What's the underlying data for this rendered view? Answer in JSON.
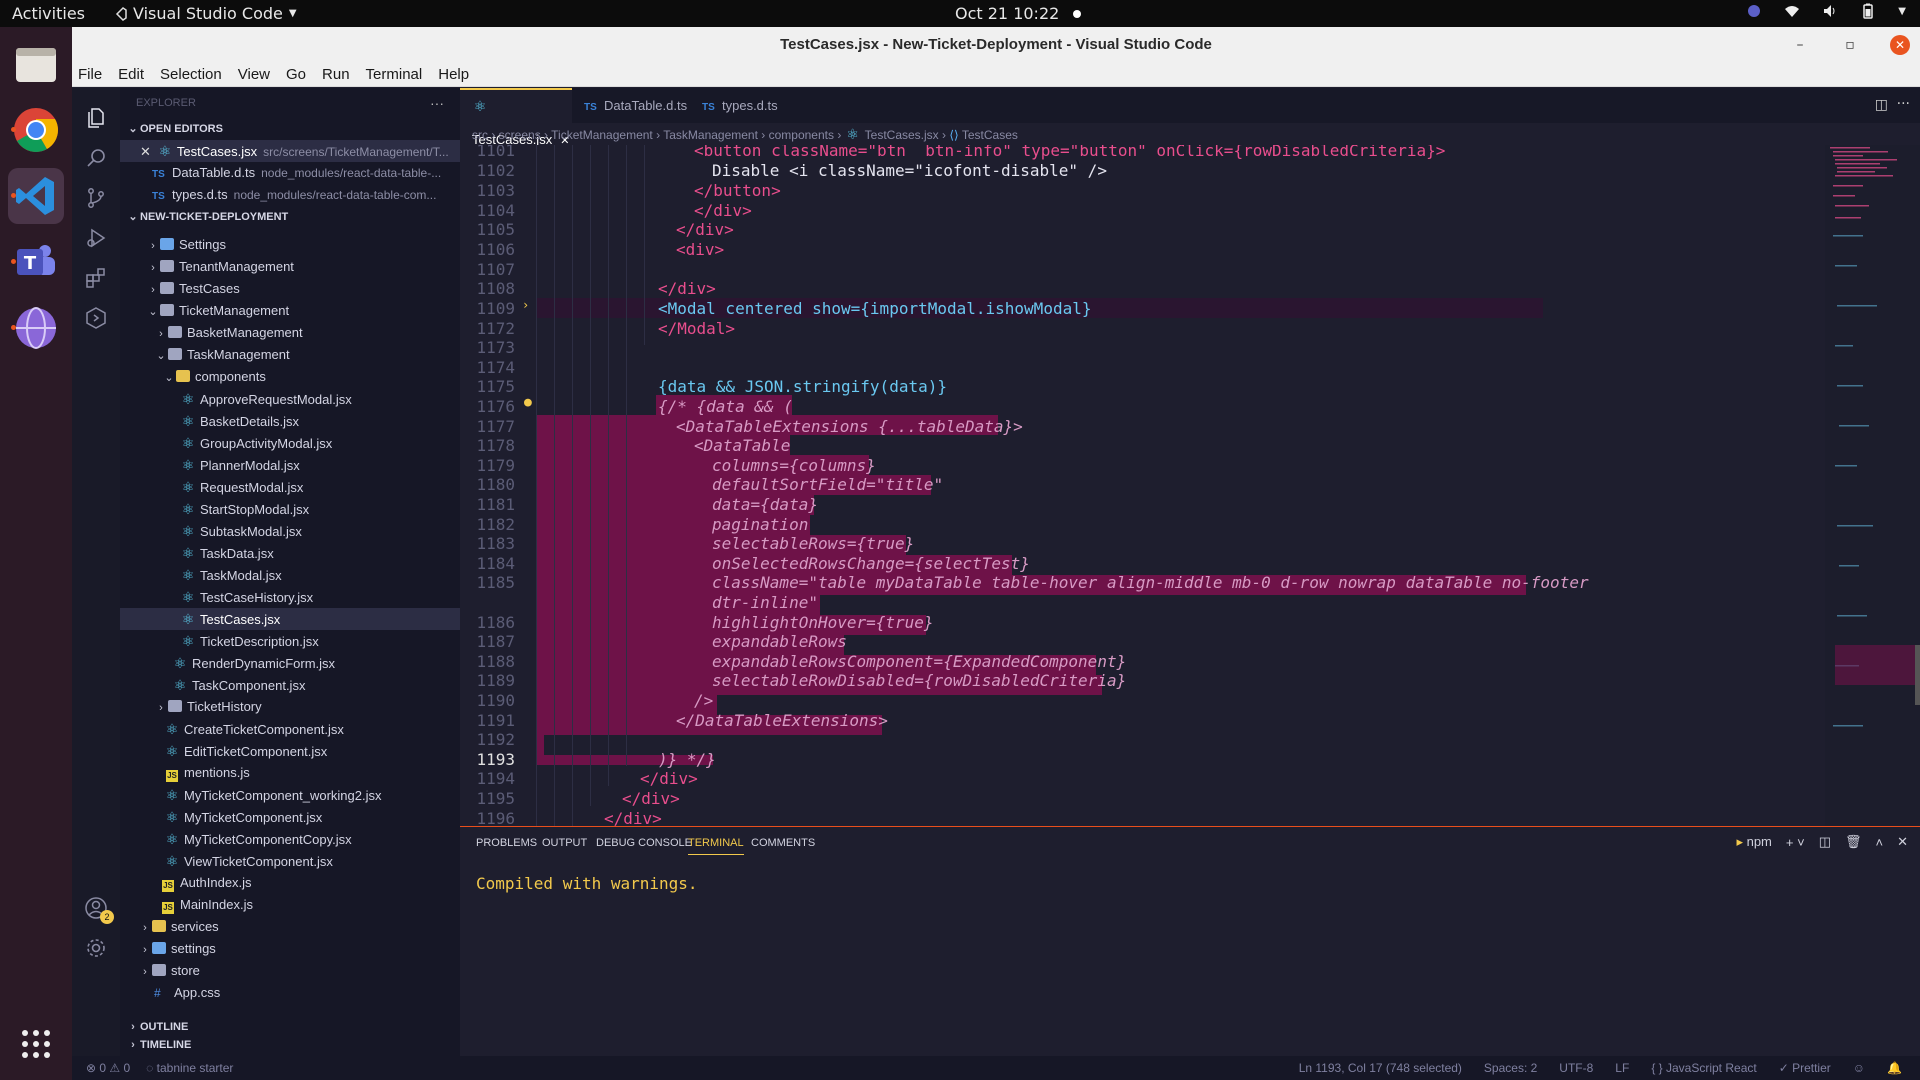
{
  "topbar": {
    "activities": "Activities",
    "app_name": "Visual Studio Code",
    "clock": "Oct 21  10:22"
  },
  "window": {
    "title": "TestCases.jsx - New-Ticket-Deployment - Visual Studio Code"
  },
  "menu": [
    "File",
    "Edit",
    "Selection",
    "View",
    "Go",
    "Run",
    "Terminal",
    "Help"
  ],
  "sidebar": {
    "title": "EXPLORER",
    "open_editors_label": "OPEN EDITORS",
    "open_editors": [
      {
        "name": "TestCases.jsx",
        "path": "src/screens/TicketManagement/T..."
      },
      {
        "name": "DataTable.d.ts",
        "path": "node_modules/react-data-table-..."
      },
      {
        "name": "types.d.ts",
        "path": "node_modules/react-data-table-com..."
      }
    ],
    "project_label": "NEW-TICKET-DEPLOYMENT",
    "tree": [
      {
        "label": "Settings"
      },
      {
        "label": "TenantManagement"
      },
      {
        "label": "TestCases"
      },
      {
        "label": "TicketManagement"
      },
      {
        "label": "BasketManagement"
      },
      {
        "label": "TaskManagement"
      },
      {
        "label": "components"
      },
      {
        "label": "ApproveRequestModal.jsx"
      },
      {
        "label": "BasketDetails.jsx"
      },
      {
        "label": "GroupActivityModal.jsx"
      },
      {
        "label": "PlannerModal.jsx"
      },
      {
        "label": "RequestModal.jsx"
      },
      {
        "label": "StartStopModal.jsx"
      },
      {
        "label": "SubtaskModal.jsx"
      },
      {
        "label": "TaskData.jsx"
      },
      {
        "label": "TaskModal.jsx"
      },
      {
        "label": "TestCaseHistory.jsx"
      },
      {
        "label": "TestCases.jsx"
      },
      {
        "label": "TicketDescription.jsx"
      },
      {
        "label": "RenderDynamicForm.jsx"
      },
      {
        "label": "TaskComponent.jsx"
      },
      {
        "label": "TicketHistory"
      },
      {
        "label": "CreateTicketComponent.jsx"
      },
      {
        "label": "EditTicketComponent.jsx"
      },
      {
        "label": "mentions.js"
      },
      {
        "label": "MyTicketComponent_working2.jsx"
      },
      {
        "label": "MyTicketComponent.jsx"
      },
      {
        "label": "MyTicketComponentCopy.jsx"
      },
      {
        "label": "ViewTicketComponent.jsx"
      },
      {
        "label": "AuthIndex.js"
      },
      {
        "label": "MainIndex.js"
      },
      {
        "label": "services"
      },
      {
        "label": "settings"
      },
      {
        "label": "store"
      },
      {
        "label": "App.css"
      }
    ],
    "outline_label": "OUTLINE",
    "timeline_label": "TIMELINE"
  },
  "tabs": [
    {
      "label": "TestCases.jsx"
    },
    {
      "label": "DataTable.d.ts"
    },
    {
      "label": "types.d.ts"
    }
  ],
  "breadcrumb": [
    "src",
    "screens",
    "TicketManagement",
    "TaskManagement",
    "components",
    "TestCases.jsx",
    "TestCases"
  ],
  "code": [
    {
      "n": "1101",
      "text": "<button className=\"btn  btn-info\" type=\"button\" onClick={rowDisabledCriteria}>"
    },
    {
      "n": "1102",
      "text": "Disable <i className=\"icofont-disable\" />"
    },
    {
      "n": "1103",
      "text": "</button>"
    },
    {
      "n": "1104",
      "text": "</div>"
    },
    {
      "n": "1105",
      "text": "</div>"
    },
    {
      "n": "1106",
      "text": "<div>"
    },
    {
      "n": "1107",
      "text": ""
    },
    {
      "n": "1108",
      "text": "</div>"
    },
    {
      "n": "1109",
      "text": "<Modal centered show={importModal.ishowModal}"
    },
    {
      "n": "1172",
      "text": "</Modal>"
    },
    {
      "n": "1173",
      "text": ""
    },
    {
      "n": "1174",
      "text": ""
    },
    {
      "n": "1175",
      "text": "{data && JSON.stringify(data)}"
    },
    {
      "n": "1176",
      "text": "{/* {data && ("
    },
    {
      "n": "1177",
      "text": "<DataTableExtensions {...tableData}>"
    },
    {
      "n": "1178",
      "text": "<DataTable"
    },
    {
      "n": "1179",
      "text": "columns={columns}"
    },
    {
      "n": "1180",
      "text": "defaultSortField=\"title\""
    },
    {
      "n": "1181",
      "text": "data={data}"
    },
    {
      "n": "1182",
      "text": "pagination"
    },
    {
      "n": "1183",
      "text": "selectableRows={true}"
    },
    {
      "n": "1184",
      "text": "onSelectedRowsChange={selectTest}"
    },
    {
      "n": "1185",
      "text": "className=\"table myDataTable table-hover align-middle mb-0 d-row nowrap dataTable no-footer"
    },
    {
      "n": "",
      "text": "dtr-inline\""
    },
    {
      "n": "1186",
      "text": "highlightOnHover={true}"
    },
    {
      "n": "1187",
      "text": "expandableRows"
    },
    {
      "n": "1188",
      "text": "expandableRowsComponent={ExpandedComponent}"
    },
    {
      "n": "1189",
      "text": "selectableRowDisabled={rowDisabledCriteria}"
    },
    {
      "n": "1190",
      "text": "/>"
    },
    {
      "n": "1191",
      "text": "</DataTableExtensions>"
    },
    {
      "n": "1192",
      "text": ""
    },
    {
      "n": "1193",
      "text": ")} */}"
    },
    {
      "n": "1194",
      "text": "</div>"
    },
    {
      "n": "1195",
      "text": "</div>"
    },
    {
      "n": "1196",
      "text": "</div>"
    }
  ],
  "panel": {
    "tabs": [
      "PROBLEMS",
      "OUTPUT",
      "DEBUG CONSOLE",
      "TERMINAL",
      "COMMENTS"
    ],
    "active_tab": "TERMINAL",
    "terminal_name": "npm",
    "output": "Compiled with warnings."
  },
  "status": {
    "errors": "⊗ 0 ⚠ 0",
    "tabnine": "tabnine starter",
    "position": "Ln 1193, Col 17 (748 selected)",
    "spaces": "Spaces: 2",
    "encoding": "UTF-8",
    "eol": "LF",
    "language": "{ } JavaScript React",
    "prettier": "✓ Prettier"
  },
  "dock": {
    "badge": "2"
  },
  "colors": {
    "accent": "#f2c94c",
    "selection": "#6e1248",
    "ubuntu_orange": "#e95420"
  }
}
